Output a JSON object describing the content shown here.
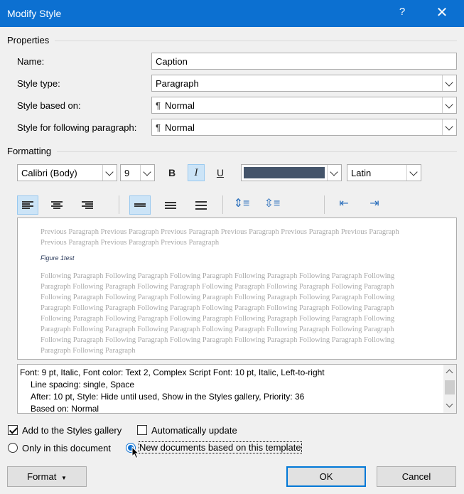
{
  "window": {
    "title": "Modify Style",
    "help": "?",
    "close": "✕"
  },
  "properties": {
    "label": "Properties",
    "name_label": "Name:",
    "name_value": "Caption",
    "style_type_label": "Style type:",
    "style_type_value": "Paragraph",
    "based_on_label": "Style based on:",
    "based_on_value": "Normal",
    "following_label": "Style for following paragraph:",
    "following_value": "Normal"
  },
  "formatting": {
    "label": "Formatting",
    "font": "Calibri (Body)",
    "size": "9",
    "bold": "B",
    "italic": "I",
    "underline": "U",
    "font_color": "#44546a",
    "script": "Latin"
  },
  "preview": {
    "previous": "Previous Paragraph Previous Paragraph Previous Paragraph Previous Paragraph Previous Paragraph Previous Paragraph Previous Paragraph Previous Paragraph Previous Paragraph",
    "caption": "Figure 1test",
    "following": "Following Paragraph Following Paragraph Following Paragraph Following Paragraph Following Paragraph Following Paragraph Following Paragraph Following Paragraph Following Paragraph Following Paragraph Following Paragraph Following Paragraph Following Paragraph Following Paragraph Following Paragraph Following Paragraph Following Paragraph Following Paragraph Following Paragraph Following Paragraph Following Paragraph Following Paragraph Following Paragraph Following Paragraph Following Paragraph Following Paragraph Following Paragraph Following Paragraph Following Paragraph Following Paragraph Following Paragraph Following Paragraph Following Paragraph Following Paragraph Following Paragraph Following Paragraph Following Paragraph Following Paragraph Following Paragraph Following Paragraph"
  },
  "description": {
    "line1": "Font: 9 pt, Italic, Font color: Text 2, Complex Script Font: 10 pt, Italic, Left-to-right",
    "line2": "Line spacing:  single, Space",
    "line3": "After:  10 pt, Style: Hide until used, Show in the Styles gallery, Priority: 36",
    "line4": "Based on: Normal"
  },
  "options": {
    "add_to_gallery": "Add to the Styles gallery",
    "add_to_gallery_checked": true,
    "auto_update": "Automatically update",
    "auto_update_checked": false,
    "only_this_doc": "Only in this document",
    "new_docs": "New documents based on this template",
    "selected": "new_docs"
  },
  "buttons": {
    "format": "Format",
    "ok": "OK",
    "cancel": "Cancel"
  }
}
